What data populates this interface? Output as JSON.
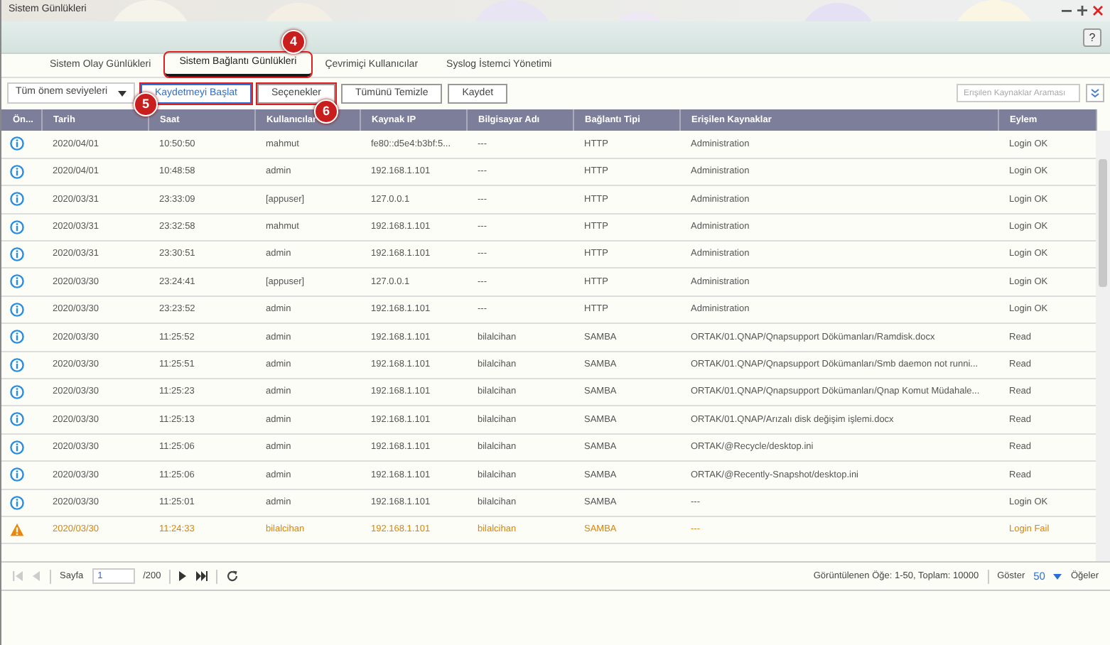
{
  "window": {
    "title": "Sistem Günlükleri",
    "help": "?"
  },
  "tabs": [
    {
      "label": "Sistem Olay Günlükleri",
      "selected": false,
      "highlighted": false
    },
    {
      "label": "Sistem Bağlantı Günlükleri",
      "selected": true,
      "highlighted": true
    },
    {
      "label": "Çevrimiçi Kullanıcılar",
      "selected": false,
      "highlighted": false
    },
    {
      "label": "Syslog İstemci Yönetimi",
      "selected": false,
      "highlighted": false
    }
  ],
  "severity_filter": {
    "value": "Tüm önem seviyeleri"
  },
  "buttons": [
    {
      "label": "Kaydetmeyi Başlat",
      "kind": "primary",
      "highlighted": true
    },
    {
      "label": "Seçenekler",
      "kind": "default",
      "highlighted": true
    },
    {
      "label": "Tümünü Temizle",
      "kind": "default",
      "highlighted": false
    },
    {
      "label": "Kaydet",
      "kind": "default",
      "highlighted": false
    }
  ],
  "search": {
    "placeholder": "Erişilen Kaynaklar Araması"
  },
  "table": {
    "columns": [
      "Ön...",
      "Tarih",
      "Saat",
      "Kullanıcılar",
      "Kaynak IP",
      "Bilgisayar Adı",
      "Bağlantı Tipi",
      "Erişilen Kaynaklar",
      "Eylem"
    ],
    "rows": [
      {
        "kind": "info",
        "cells": [
          "",
          "2020/04/01",
          "10:50:50",
          "mahmut",
          "fe80::d5e4:b3bf:5...",
          "---",
          "HTTP",
          "Administration",
          "Login OK"
        ]
      },
      {
        "kind": "info",
        "cells": [
          "",
          "2020/04/01",
          "10:48:58",
          "admin",
          "192.168.1.101",
          "---",
          "HTTP",
          "Administration",
          "Login OK"
        ]
      },
      {
        "kind": "info",
        "cells": [
          "",
          "2020/03/31",
          "23:33:09",
          "[appuser]",
          "127.0.0.1",
          "---",
          "HTTP",
          "Administration",
          "Login OK"
        ]
      },
      {
        "kind": "info",
        "cells": [
          "",
          "2020/03/31",
          "23:32:58",
          "mahmut",
          "192.168.1.101",
          "---",
          "HTTP",
          "Administration",
          "Login OK"
        ]
      },
      {
        "kind": "info",
        "cells": [
          "",
          "2020/03/31",
          "23:30:51",
          "admin",
          "192.168.1.101",
          "---",
          "HTTP",
          "Administration",
          "Login OK"
        ]
      },
      {
        "kind": "info",
        "cells": [
          "",
          "2020/03/30",
          "23:24:41",
          "[appuser]",
          "127.0.0.1",
          "---",
          "HTTP",
          "Administration",
          "Login OK"
        ]
      },
      {
        "kind": "info",
        "cells": [
          "",
          "2020/03/30",
          "23:23:52",
          "admin",
          "192.168.1.101",
          "---",
          "HTTP",
          "Administration",
          "Login OK"
        ]
      },
      {
        "kind": "info",
        "cells": [
          "",
          "2020/03/30",
          "11:25:52",
          "admin",
          "192.168.1.101",
          "bilalcihan",
          "SAMBA",
          "ORTAK/01.QNAP/Qnapsupport Dökümanları/Ramdisk.docx",
          "Read"
        ]
      },
      {
        "kind": "info",
        "cells": [
          "",
          "2020/03/30",
          "11:25:51",
          "admin",
          "192.168.1.101",
          "bilalcihan",
          "SAMBA",
          "ORTAK/01.QNAP/Qnapsupport Dökümanları/Smb daemon not runni...",
          "Read"
        ]
      },
      {
        "kind": "info",
        "cells": [
          "",
          "2020/03/30",
          "11:25:23",
          "admin",
          "192.168.1.101",
          "bilalcihan",
          "SAMBA",
          "ORTAK/01.QNAP/Qnapsupport Dökümanları/Qnap Komut Müdahale...",
          "Read"
        ]
      },
      {
        "kind": "info",
        "cells": [
          "",
          "2020/03/30",
          "11:25:13",
          "admin",
          "192.168.1.101",
          "bilalcihan",
          "SAMBA",
          "ORTAK/01.QNAP/Arızalı disk değişim işlemi.docx",
          "Read"
        ]
      },
      {
        "kind": "info",
        "cells": [
          "",
          "2020/03/30",
          "11:25:06",
          "admin",
          "192.168.1.101",
          "bilalcihan",
          "SAMBA",
          "ORTAK/@Recycle/desktop.ini",
          "Read"
        ]
      },
      {
        "kind": "info",
        "cells": [
          "",
          "2020/03/30",
          "11:25:06",
          "admin",
          "192.168.1.101",
          "bilalcihan",
          "SAMBA",
          "ORTAK/@Recently-Snapshot/desktop.ini",
          "Read"
        ]
      },
      {
        "kind": "info",
        "cells": [
          "",
          "2020/03/30",
          "11:25:01",
          "admin",
          "192.168.1.101",
          "bilalcihan",
          "SAMBA",
          "---",
          "Login OK"
        ]
      },
      {
        "kind": "warning",
        "cells": [
          "",
          "2020/03/30",
          "11:24:33",
          "bilalcihan",
          "192.168.1.101",
          "bilalcihan",
          "SAMBA",
          "---",
          "Login Fail"
        ]
      }
    ]
  },
  "pager": {
    "page_label": "Sayfa",
    "page": "1",
    "page_total": "/200",
    "summary": "Görüntülenen Öğe: 1-50, Toplam: 10000",
    "show_label": "Göster",
    "page_size": "50",
    "items_label": "Öğeler"
  },
  "annotations": [
    {
      "label": "4"
    },
    {
      "label": "5"
    },
    {
      "label": "6"
    }
  ]
}
